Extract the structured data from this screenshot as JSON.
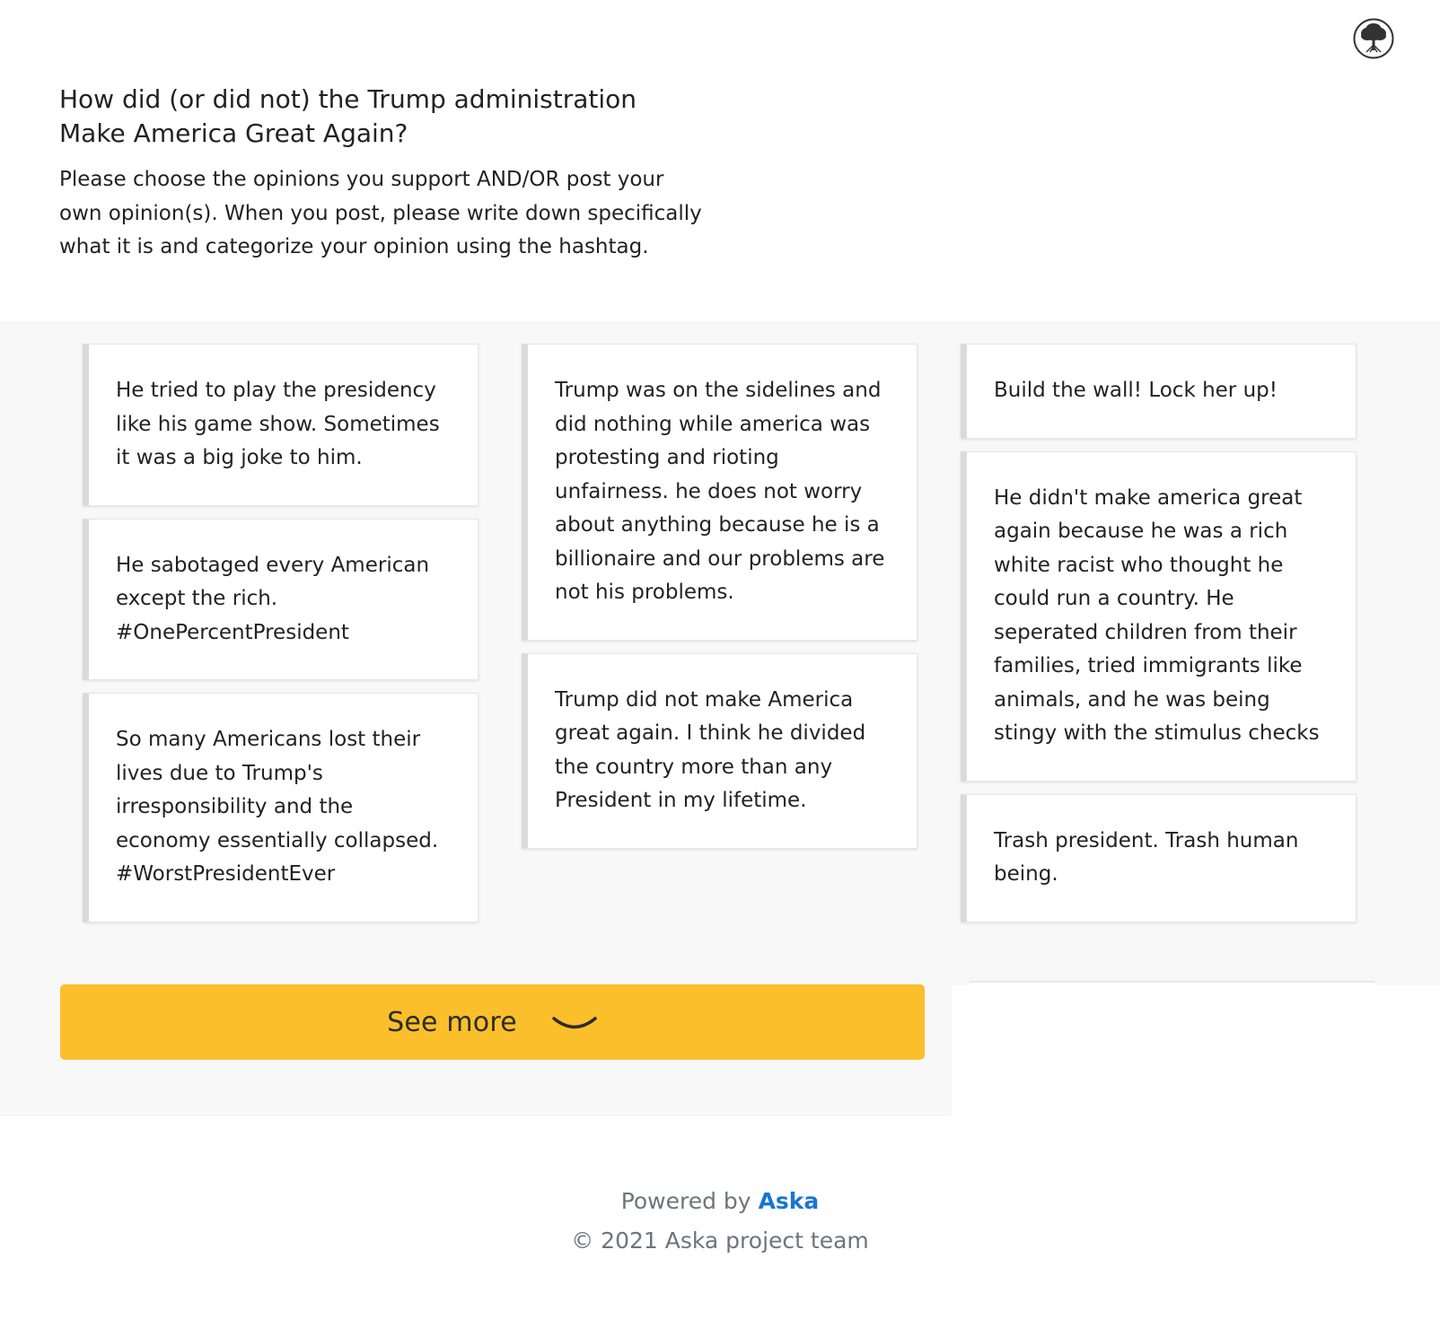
{
  "header": {
    "title": "How did (or did not) the Trump administration Make America Great Again?",
    "description": "Please choose the opinions you support AND/OR post your own opinion(s). When you post, please write down specifically what it is and categorize your opinion using the hashtag."
  },
  "avatar": {
    "icon": "tree-icon"
  },
  "opinions": {
    "col0": [
      "He tried to play the presidency like his game show. Sometimes it was a big joke to him.",
      "He sabotaged every American except the rich. #OnePercentPresident",
      "So many Americans lost their lives due to Trump's irresponsibility and the economy essentially collapsed. #WorstPresidentEver"
    ],
    "col1": [
      "Trump was on the sidelines and did nothing while america was protesting and rioting unfairness. he does not worry about anything because he is a billionaire and our problems are not his problems.",
      "Trump did not make America great again. I think he divided the country more than any President in my lifetime."
    ],
    "col2": [
      "Build the wall! Lock her up!",
      "He didn't make america great again because he was a rich white racist who thought he could run a country. He seperated children from their families, tried immigrants like animals, and he was being stingy with the stimulus checks",
      "Trash president. Trash human being."
    ]
  },
  "see_more": {
    "label": "See more",
    "icon": "chevron-down-icon",
    "color": "#fbbf2b"
  },
  "footer": {
    "powered_prefix": "Powered by",
    "brand": "Aska",
    "brand_color": "#1976d2",
    "copyright": "© 2021 Aska project team"
  }
}
